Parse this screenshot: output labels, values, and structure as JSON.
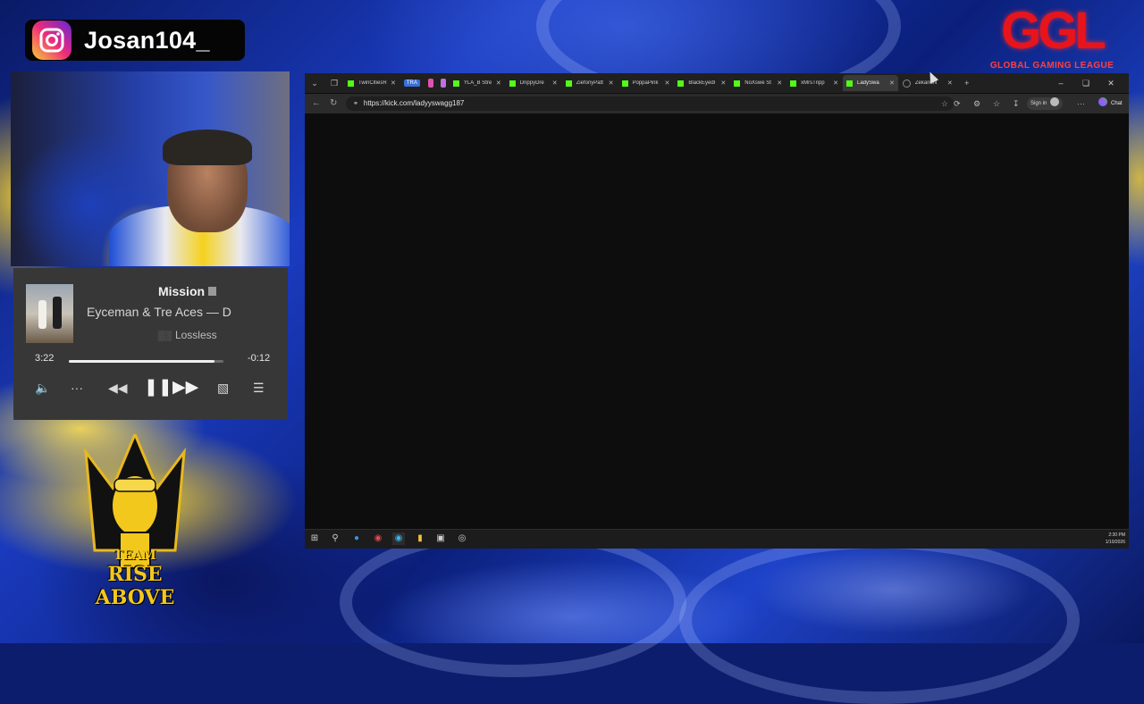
{
  "overlay": {
    "instagram_handle": "Josan104_",
    "ggl_letters": "GGL",
    "ggl_tagline": "GLOBAL GAMING LEAGUE",
    "team_logo_top": "TEAM",
    "team_logo_main": "RISE ABOVE"
  },
  "player": {
    "title": "Mission",
    "artist": "Eyceman & Tre Aces — D",
    "quality": "Lossless",
    "elapsed": "3:22",
    "remaining": "-0:12",
    "progress_fraction": 0.94,
    "icons": {
      "volume": "volume-icon",
      "more": "more-icon",
      "previous": "rewind-icon",
      "play_pause": "pause-icon",
      "next": "fast-forward-icon",
      "lyrics": "lyrics-icon",
      "queue": "queue-icon"
    }
  },
  "browser": {
    "tabs": [
      {
        "label": "TwinCitiesR",
        "type": "kick"
      },
      {
        "label": "TRA",
        "type": "badge"
      },
      {
        "label": "",
        "type": "pill"
      },
      {
        "label": "YLA_B Stre",
        "type": "kick"
      },
      {
        "label": "DrippyDre",
        "type": "kick"
      },
      {
        "label": "ZiefonyPatt",
        "type": "kick"
      },
      {
        "label": "PoppaPink",
        "type": "kick"
      },
      {
        "label": "BlackEyedl",
        "type": "kick"
      },
      {
        "label": "NoXswe St",
        "type": "kick"
      },
      {
        "label": "xMrsTripp",
        "type": "kick"
      },
      {
        "label": "LadySwa",
        "type": "kick",
        "active": true
      },
      {
        "label": "ZekarioN",
        "type": "loading"
      }
    ],
    "url": "https://kick.com/ladyyswagg187",
    "sign_in_label": "Sign in",
    "chat_label": "Chat",
    "clock_time": "2:30 PM",
    "clock_date": "1/10/2026"
  },
  "colors": {
    "kick_green": "#53fc18",
    "ggl_red": "#e8141c",
    "player_bg": "#373737"
  }
}
